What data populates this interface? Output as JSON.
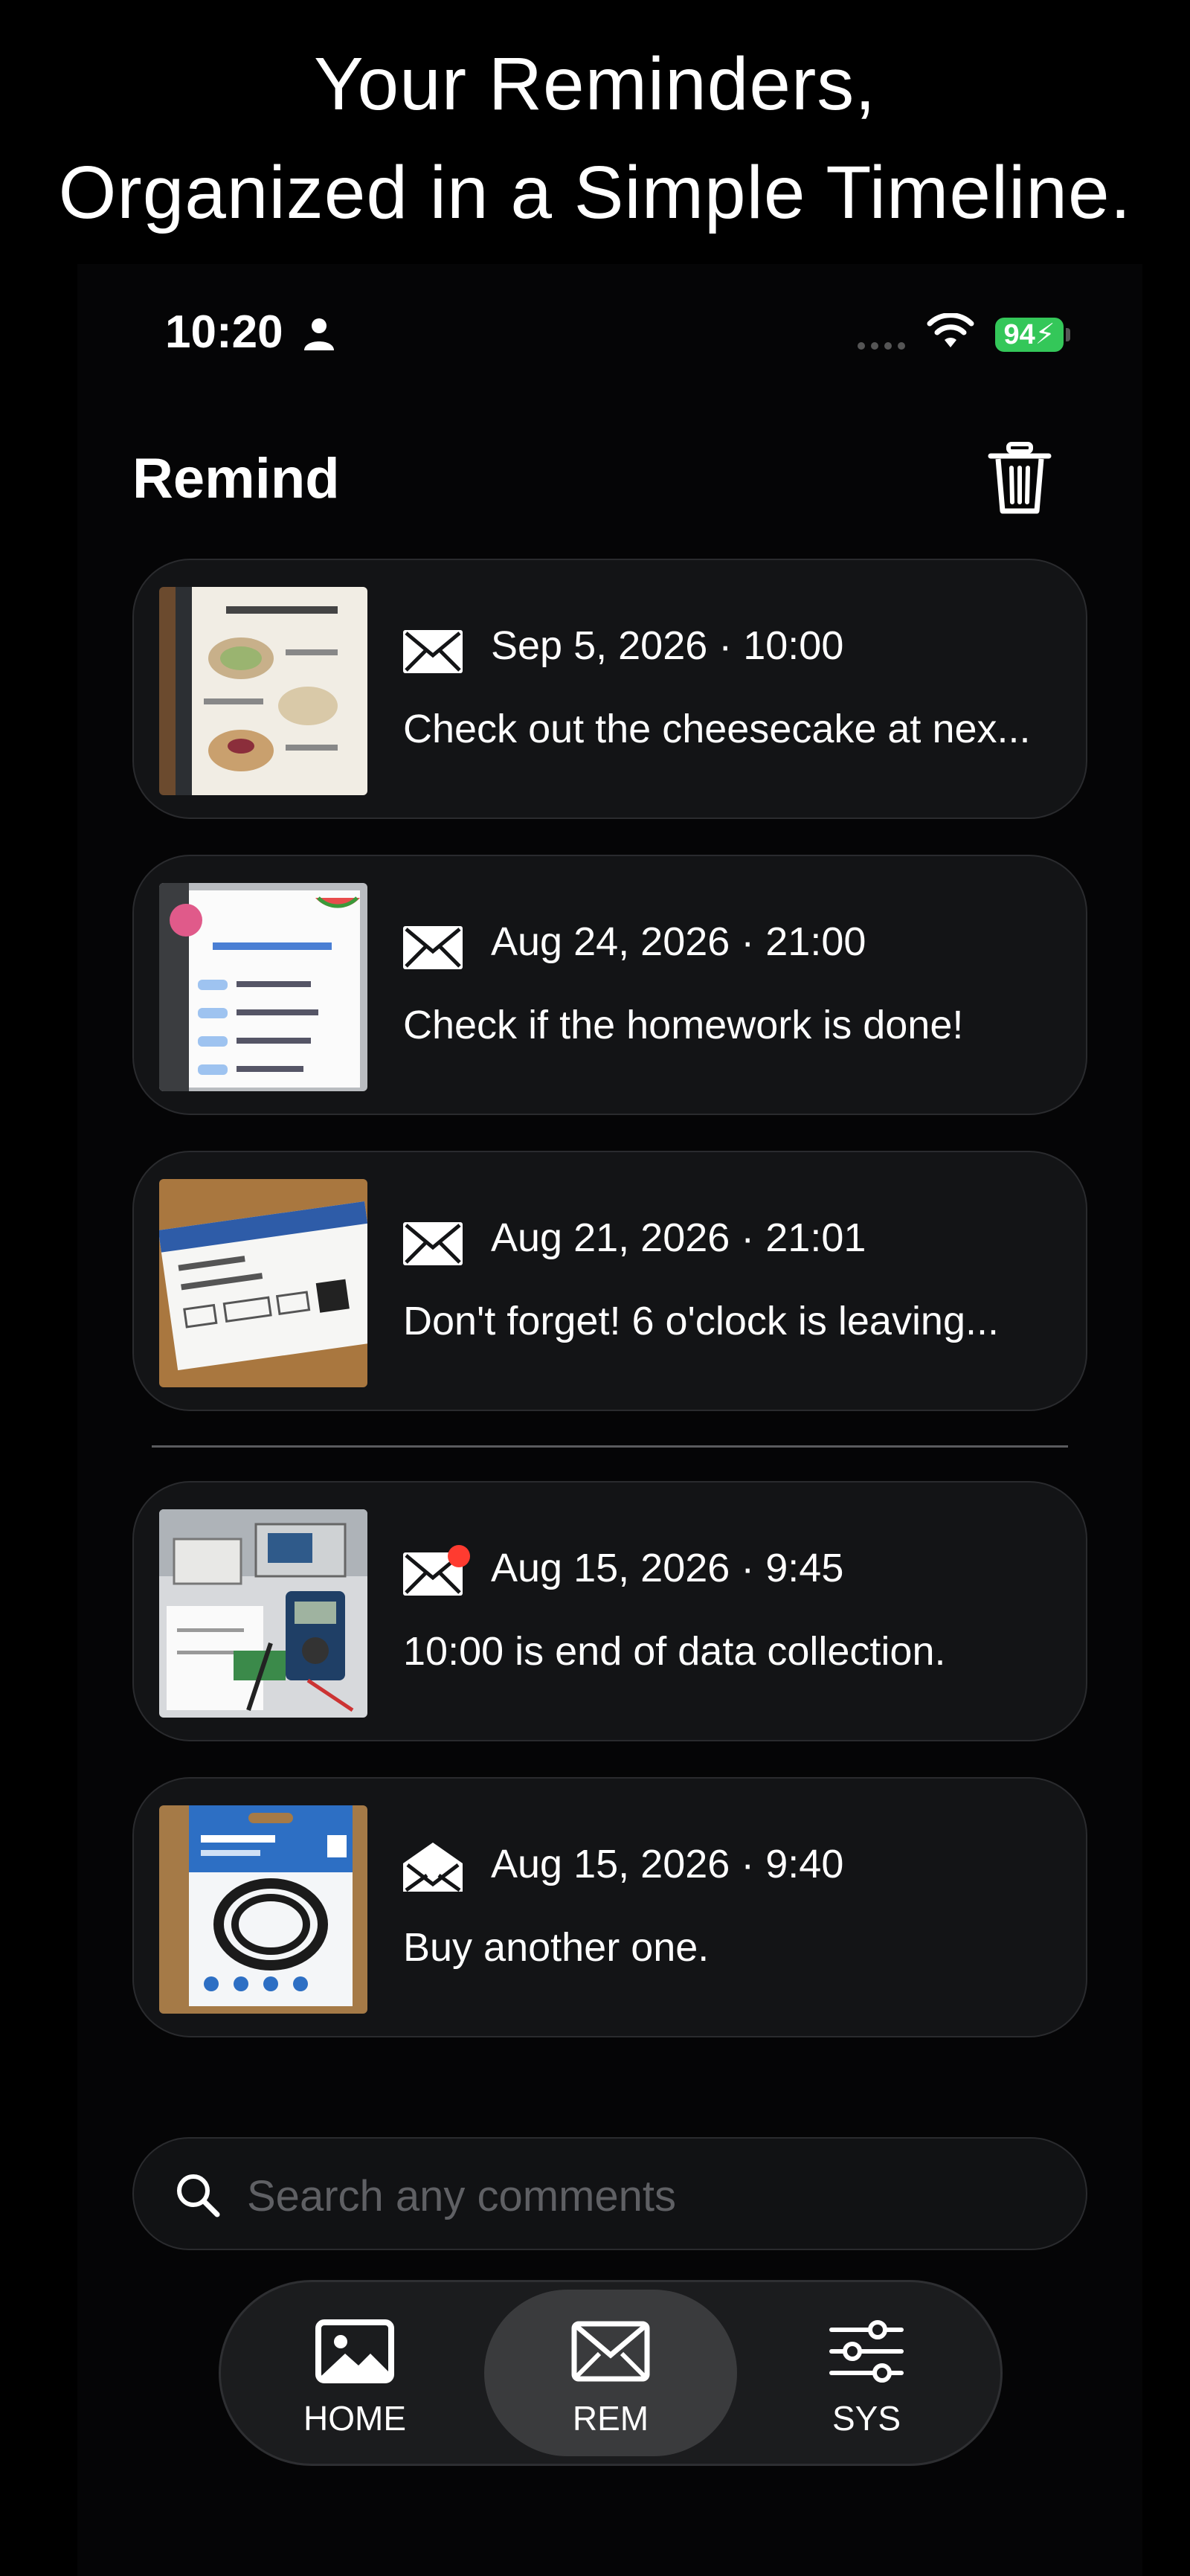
{
  "headline": {
    "line1": "Your Reminders,",
    "line2": "Organized in a Simple Timeline."
  },
  "status_bar": {
    "time": "10:20",
    "battery": "94"
  },
  "app": {
    "title": "Remind"
  },
  "reminders": [
    {
      "date": "Sep 5, 2026 · 10:00",
      "message": "Check out the cheesecake at nex...",
      "thumbnail": "restaurant-menu-photo",
      "mail_icon": "envelope-closed-icon",
      "unread": false
    },
    {
      "date": "Aug 24, 2026 · 21:00",
      "message": "Check if the homework is done!",
      "thumbnail": "summer-schedule-photo",
      "mail_icon": "envelope-closed-icon",
      "unread": false
    },
    {
      "date": "Aug 21, 2026 · 21:01",
      "message": "Don't forget!  6 o'clock is leaving...",
      "thumbnail": "boarding-pass-photo",
      "mail_icon": "envelope-closed-icon",
      "unread": false
    },
    {
      "date": "Aug 15, 2026 · 9:45",
      "message": "10:00 is end of data collection.",
      "thumbnail": "lab-equipment-photo",
      "mail_icon": "envelope-closed-icon",
      "unread": true
    },
    {
      "date": "Aug 15, 2026 · 9:40",
      "message": "Buy another one.",
      "thumbnail": "usb-c-cable-photo",
      "mail_icon": "envelope-open-icon",
      "unread": false
    }
  ],
  "search": {
    "placeholder": "Search any comments"
  },
  "tabs": [
    {
      "label": "HOME",
      "icon": "image-icon",
      "active": false
    },
    {
      "label": "REM",
      "icon": "envelope-icon",
      "active": true
    },
    {
      "label": "SYS",
      "icon": "sliders-icon",
      "active": false
    }
  ],
  "colors": {
    "background": "#000000",
    "card": "#131416",
    "battery": "#34c759",
    "unread_dot": "#ff3b30",
    "active_tab": "#3a3b3d"
  }
}
